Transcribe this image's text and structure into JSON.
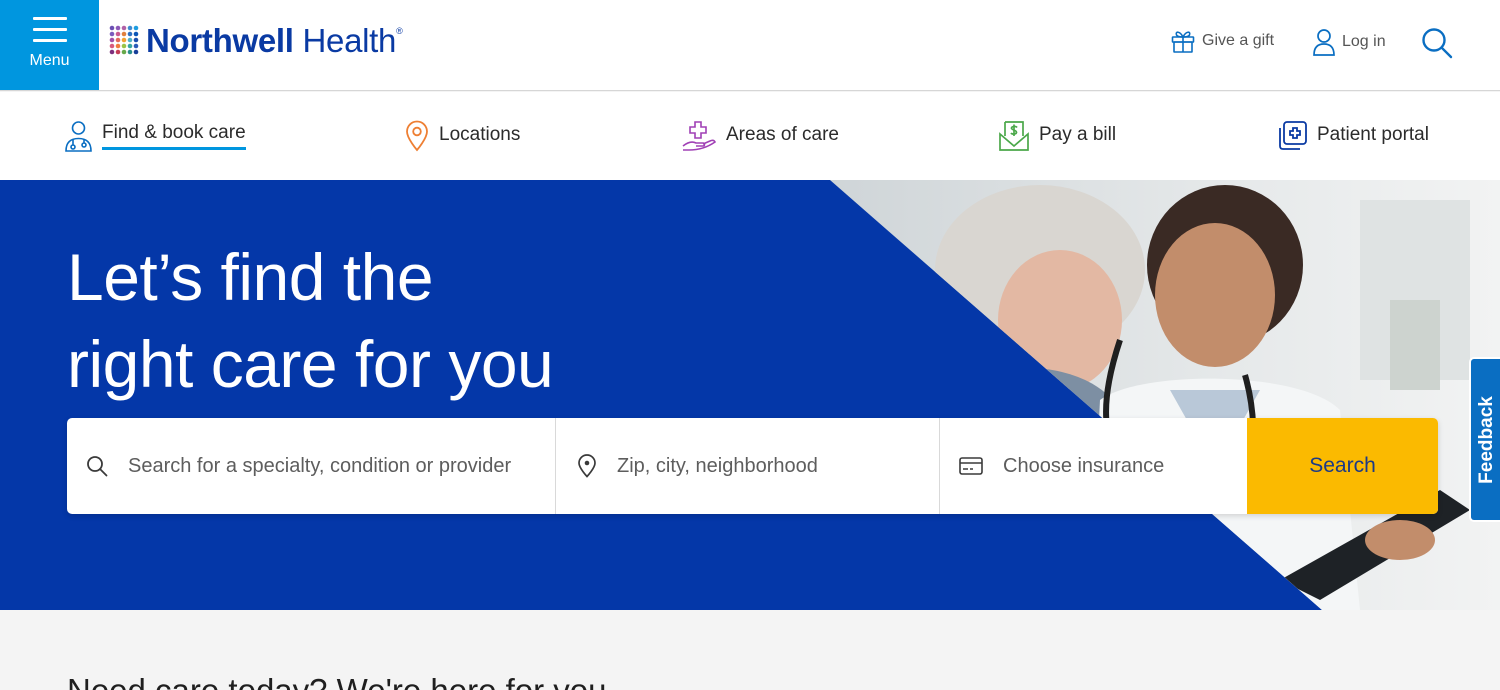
{
  "header": {
    "menu_label": "Menu",
    "brand_bold": "Northwell",
    "brand_light": "Health",
    "brand_mark": "®",
    "give_gift": "Give a gift",
    "log_in": "Log in"
  },
  "nav": {
    "items": [
      {
        "label": "Find & book care",
        "icon": "person-stethoscope-icon"
      },
      {
        "label": "Locations",
        "icon": "map-pin-icon"
      },
      {
        "label": "Areas of care",
        "icon": "hand-cross-icon"
      },
      {
        "label": "Pay a bill",
        "icon": "bill-dollar-icon"
      },
      {
        "label": "Patient portal",
        "icon": "portal-cross-icon"
      }
    ],
    "active": "Find & book care"
  },
  "hero": {
    "heading_line1": "Let’s find the",
    "heading_line2": "right care for you",
    "search_placeholder": "Search for a specialty, condition or provider",
    "location_placeholder": "Zip, city, neighborhood",
    "insurance_placeholder": "Choose insurance",
    "search_button": "Search"
  },
  "feedback": {
    "label": "Feedback"
  },
  "section": {
    "title": "Need care today? We're here for you"
  },
  "colors": {
    "hero_blue": "#0437a8",
    "menu_blue": "#0096df",
    "search_yellow": "#fbba00",
    "brand_navy": "#0a3aa3"
  }
}
